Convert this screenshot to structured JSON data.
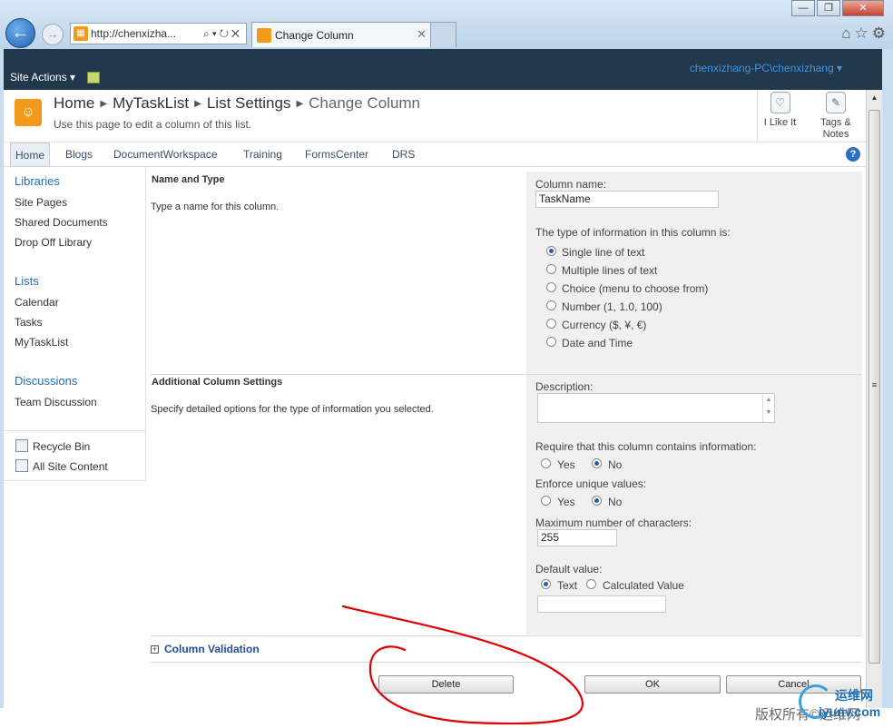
{
  "browser": {
    "url": "http://chenxizha...",
    "tab_title": "Change Column",
    "back_icon": "back-arrow-icon",
    "forward_icon": "forward-arrow-icon"
  },
  "sharepoint": {
    "site_actions": "Site Actions",
    "user": "chenxizhang-PC\\chenxizhang",
    "breadcrumb": [
      "Home",
      "MyTaskList",
      "List Settings",
      "Change Column"
    ],
    "subtitle": "Use this page to edit a column of this list.",
    "ilike": "I Like It",
    "tags": [
      "Tags &",
      "Notes"
    ]
  },
  "topnav": [
    "Home",
    "Blogs",
    "DocumentWorkspace",
    "Training",
    "FormsCenter",
    "DRS"
  ],
  "leftnav": {
    "libraries": {
      "title": "Libraries",
      "items": [
        "Site Pages",
        "Shared Documents",
        "Drop Off Library"
      ]
    },
    "lists": {
      "title": "Lists",
      "items": [
        "Calendar",
        "Tasks",
        "MyTaskList"
      ]
    },
    "discussions": {
      "title": "Discussions",
      "items": [
        "Team Discussion"
      ]
    },
    "recycle_bin": "Recycle Bin",
    "all_site_content": "All Site Content"
  },
  "form": {
    "name_and_type": {
      "title": "Name and Type",
      "desc": "Type a name for this column.",
      "column_name_label": "Column name:",
      "column_name_value": "TaskName",
      "type_label": "The type of information in this column is:",
      "types": [
        "Single line of text",
        "Multiple lines of text",
        "Choice (menu to choose from)",
        "Number (1, 1.0, 100)",
        "Currency ($, ¥, €)",
        "Date and Time"
      ],
      "selected_type": "Single line of text"
    },
    "additional": {
      "title": "Additional Column Settings",
      "desc": "Specify detailed options for the type of information you selected.",
      "description_label": "Description:",
      "require_label": "Require that this column contains information:",
      "enforce_label": "Enforce unique values:",
      "yes": "Yes",
      "no": "No",
      "require_value": "No",
      "enforce_value": "No",
      "max_chars_label": "Maximum number of characters:",
      "max_chars_value": "255",
      "default_label": "Default value:",
      "default_options": [
        "Text",
        "Calculated Value"
      ],
      "default_selected": "Text"
    },
    "column_validation": "Column Validation",
    "buttons": {
      "delete": "Delete",
      "ok": "OK",
      "cancel": "Cancel"
    }
  },
  "watermark": {
    "text": "版权所有©运维网",
    "logo_top": "运维网",
    "logo_bottom": "iyunv.com"
  },
  "colors": {
    "ribbon": "#21374c",
    "link": "#1f6fb5",
    "annotation": "#e00000"
  }
}
